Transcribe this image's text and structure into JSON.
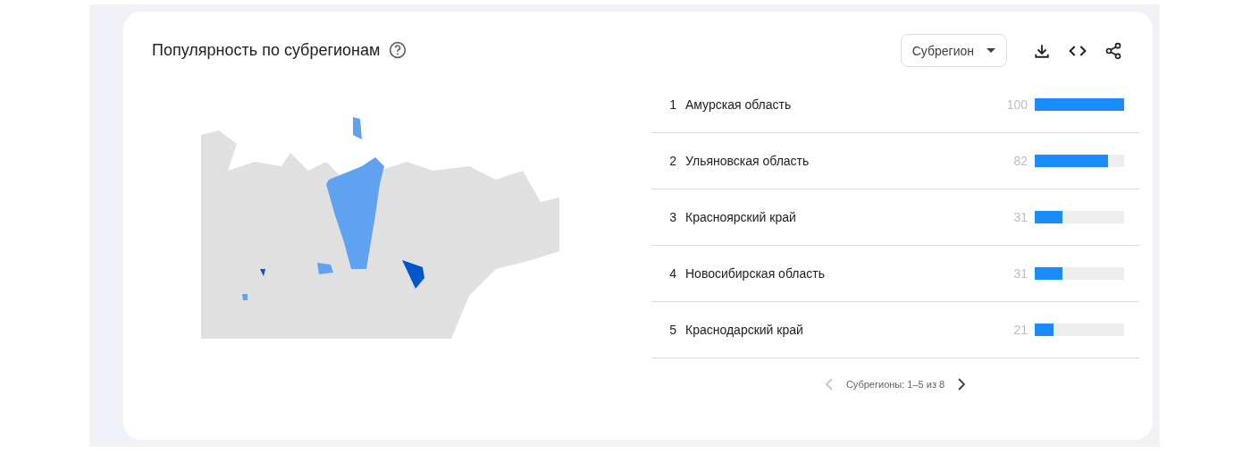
{
  "title": "Популярность по субрегионам",
  "dropdown": {
    "value": "Субрегион"
  },
  "rows": [
    {
      "rank": "1",
      "name": "Амурская область",
      "value": "100",
      "level": 1.0
    },
    {
      "rank": "2",
      "name": "Ульяновская область",
      "value": "82",
      "level": 0.82
    },
    {
      "rank": "3",
      "name": "Красноярский край",
      "value": "31",
      "level": 0.31
    },
    {
      "rank": "4",
      "name": "Новосибирская область",
      "value": "31",
      "level": 0.31
    },
    {
      "rank": "5",
      "name": "Краснодарский край",
      "value": "21",
      "level": 0.21
    }
  ],
  "pagination": {
    "label": "Субрегионы: 1–5 из 8",
    "prev_disabled": true,
    "next_disabled": false
  }
}
